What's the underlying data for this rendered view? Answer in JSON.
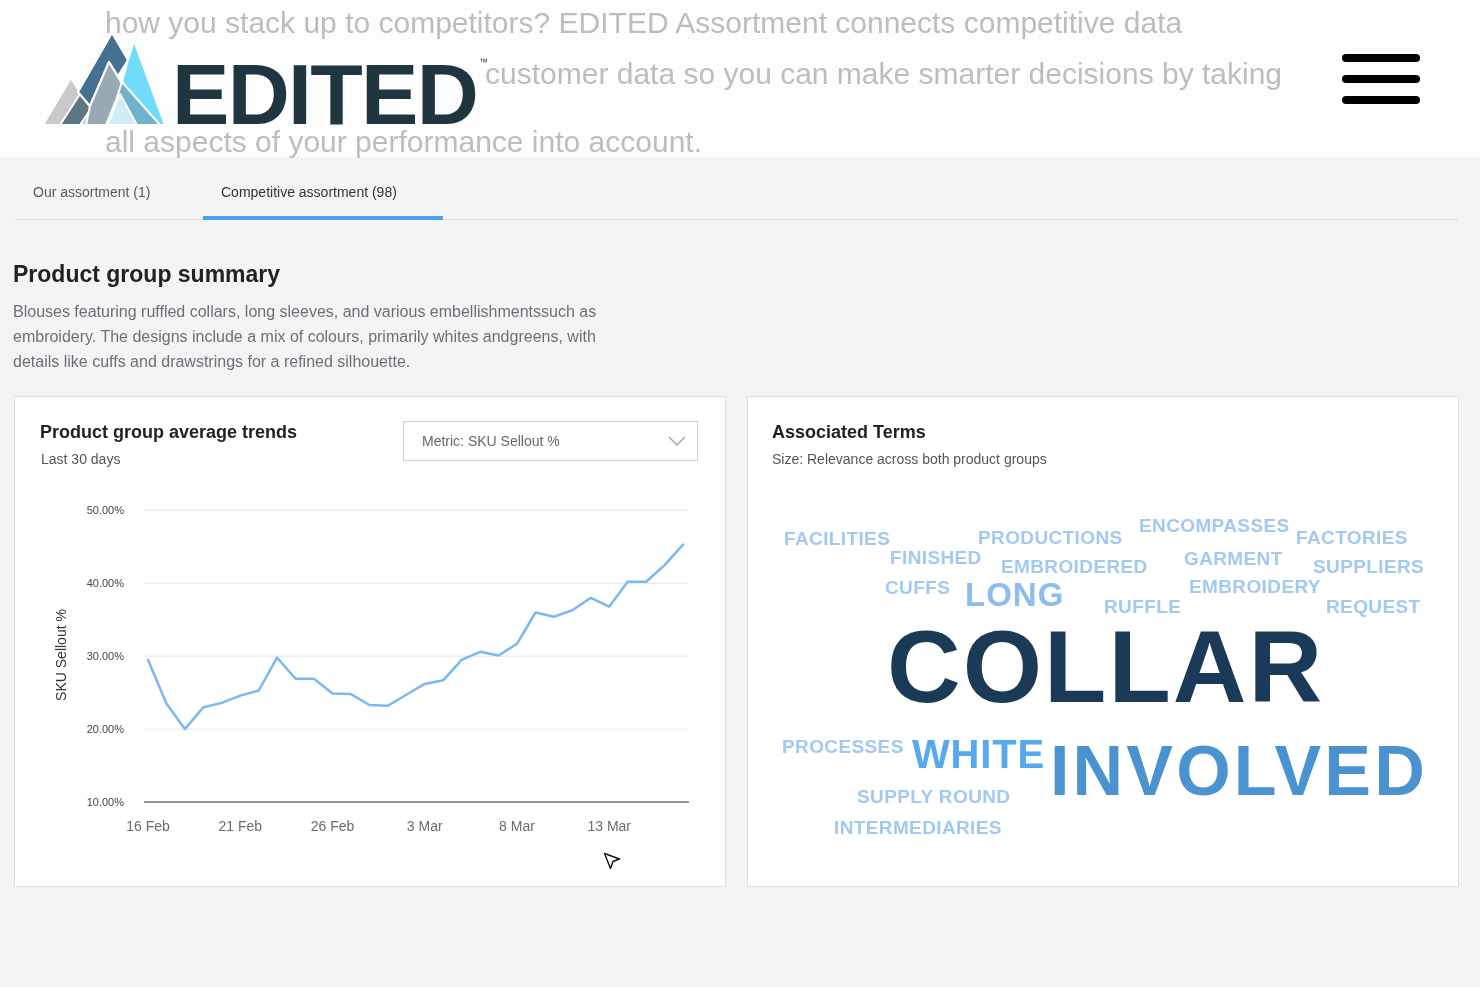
{
  "header": {
    "background_text": [
      "how you stack up to competitors? EDITED Assortment connects competitive data",
      "customer data so you can make smarter decisions by taking",
      "all aspects of your performance into account."
    ],
    "logo": {
      "text": "EDITED",
      "trademark": "™"
    }
  },
  "tabs": [
    {
      "label": "Our assortment (1)",
      "selected": false
    },
    {
      "label": "Competitive assortment (98)",
      "selected": true
    }
  ],
  "summary": {
    "title": "Product group summary",
    "text": "Blouses featuring ruffled collars, long sleeves, and various embellishmentssuch as embroidery. The designs include a mix of colours, primarily whites andgreens, with details like cuffs and drawstrings for a refined silhouette."
  },
  "trend_card": {
    "title": "Product group average trends",
    "subtitle": "Last 30 days",
    "metric_dropdown": {
      "value": "Metric: SKU Sellout %"
    },
    "chart_data": {
      "type": "line",
      "ylabel": "SKU Sellout %",
      "grid": true,
      "categories": [
        "16 Feb",
        null,
        null,
        null,
        null,
        "21 Feb",
        null,
        null,
        null,
        null,
        "26 Feb",
        null,
        null,
        null,
        null,
        "3 Mar",
        null,
        null,
        null,
        null,
        "8 Mar",
        null,
        null,
        null,
        null,
        "13 Mar",
        null,
        null,
        null,
        null
      ],
      "ylim": [
        10,
        50
      ],
      "yticks": [
        {
          "value": 50,
          "label": "50.00%"
        },
        {
          "value": 40,
          "label": "40.00%"
        },
        {
          "value": 30,
          "label": "30.00%"
        },
        {
          "value": 20,
          "label": "20.00%"
        },
        {
          "value": 10,
          "label": "10.00%"
        }
      ],
      "series": [
        {
          "color": "#7ab8f3",
          "values": [
            29.5,
            23.5,
            20.0,
            23.0,
            23.6,
            24.6,
            25.3,
            29.8,
            26.9,
            26.9,
            24.9,
            24.8,
            23.3,
            23.2,
            24.7,
            26.2,
            26.7,
            29.5,
            30.6,
            30.1,
            31.7,
            36.0,
            35.4,
            36.3,
            38.0,
            36.8,
            40.2,
            40.2,
            42.5,
            45.3
          ]
        }
      ]
    }
  },
  "terms_card": {
    "title": "Associated Terms",
    "subtitle": "Size: Relevance across both product groups",
    "terms": [
      {
        "text": "FACILITIES",
        "kind": "minor",
        "color": "#a2c9f2"
      },
      {
        "text": "PRODUCTIONS",
        "kind": "minor",
        "color": "#a2c9f2"
      },
      {
        "text": "ENCOMPASSES",
        "kind": "minor",
        "color": "#a2c9f2"
      },
      {
        "text": "FACTORIES",
        "kind": "minor",
        "color": "#a2c9f2"
      },
      {
        "text": "FINISHED",
        "kind": "minor",
        "color": "#a2c9f2"
      },
      {
        "text": "EMBROIDERED",
        "kind": "minor",
        "color": "#a2c9f2"
      },
      {
        "text": "GARMENT",
        "kind": "minor",
        "color": "#a2c9f2"
      },
      {
        "text": "SUPPLIERS",
        "kind": "minor",
        "color": "#a2c9f2"
      },
      {
        "text": "CUFFS",
        "kind": "minor",
        "color": "#a2c9f2"
      },
      {
        "text": "LONG",
        "kind": "medium",
        "color": "#8cbcf0"
      },
      {
        "text": "EMBROIDERY",
        "kind": "minor",
        "color": "#a2c9f2"
      },
      {
        "text": "RUFFLE",
        "kind": "minor",
        "color": "#a2c9f2"
      },
      {
        "text": "REQUEST",
        "kind": "minor",
        "color": "#a2c9f2"
      },
      {
        "text": "COLLAR",
        "kind": "dominant",
        "color": "#1b3a57"
      },
      {
        "text": "PROCESSES",
        "kind": "minor",
        "color": "#a2c9f2"
      },
      {
        "text": "WHITE",
        "kind": "large",
        "color": "#56a9ee"
      },
      {
        "text": "INVOLVED",
        "kind": "major",
        "color": "#4a93d0"
      },
      {
        "text": "SUPPLY ROUND",
        "kind": "minor",
        "color": "#a2c9f2"
      },
      {
        "text": "INTERMEDIARIES",
        "kind": "minor",
        "color": "#a2c9f2"
      }
    ]
  }
}
